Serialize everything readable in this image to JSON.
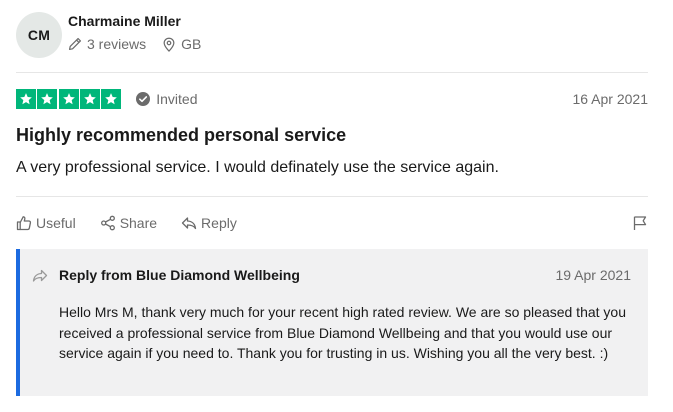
{
  "reviewer": {
    "initials": "CM",
    "name": "Charmaine Miller",
    "reviews": "3 reviews",
    "country": "GB",
    "icons": {
      "reviews": "pencil-icon",
      "location": "location-pin-icon"
    }
  },
  "rating": {
    "stars": 5,
    "max_stars": 5,
    "star_color": "#00b67a",
    "status": "Invited",
    "status_icon": "check-circle-icon",
    "date": "16 Apr 2021"
  },
  "review": {
    "title": "Highly recommended personal service",
    "text": "A very professional service. I would definately use the service again."
  },
  "actions": {
    "useful": "Useful",
    "share": "Share",
    "reply": "Reply",
    "icons": {
      "useful": "thumbs-up-icon",
      "share": "share-icon",
      "reply": "reply-arrow-icon",
      "report": "flag-icon"
    }
  },
  "company_reply": {
    "title": "Reply from Blue Diamond Wellbeing",
    "date": "19 Apr 2021",
    "text": "Hello Mrs M, thank very much for your recent high rated review. We are so pleased that you received a professional service from Blue Diamond Wellbeing and that you would use our service again if you need to. Thank you for trusting in us. Wishing you all the very best. :)",
    "accent_color": "#1c6be0"
  }
}
